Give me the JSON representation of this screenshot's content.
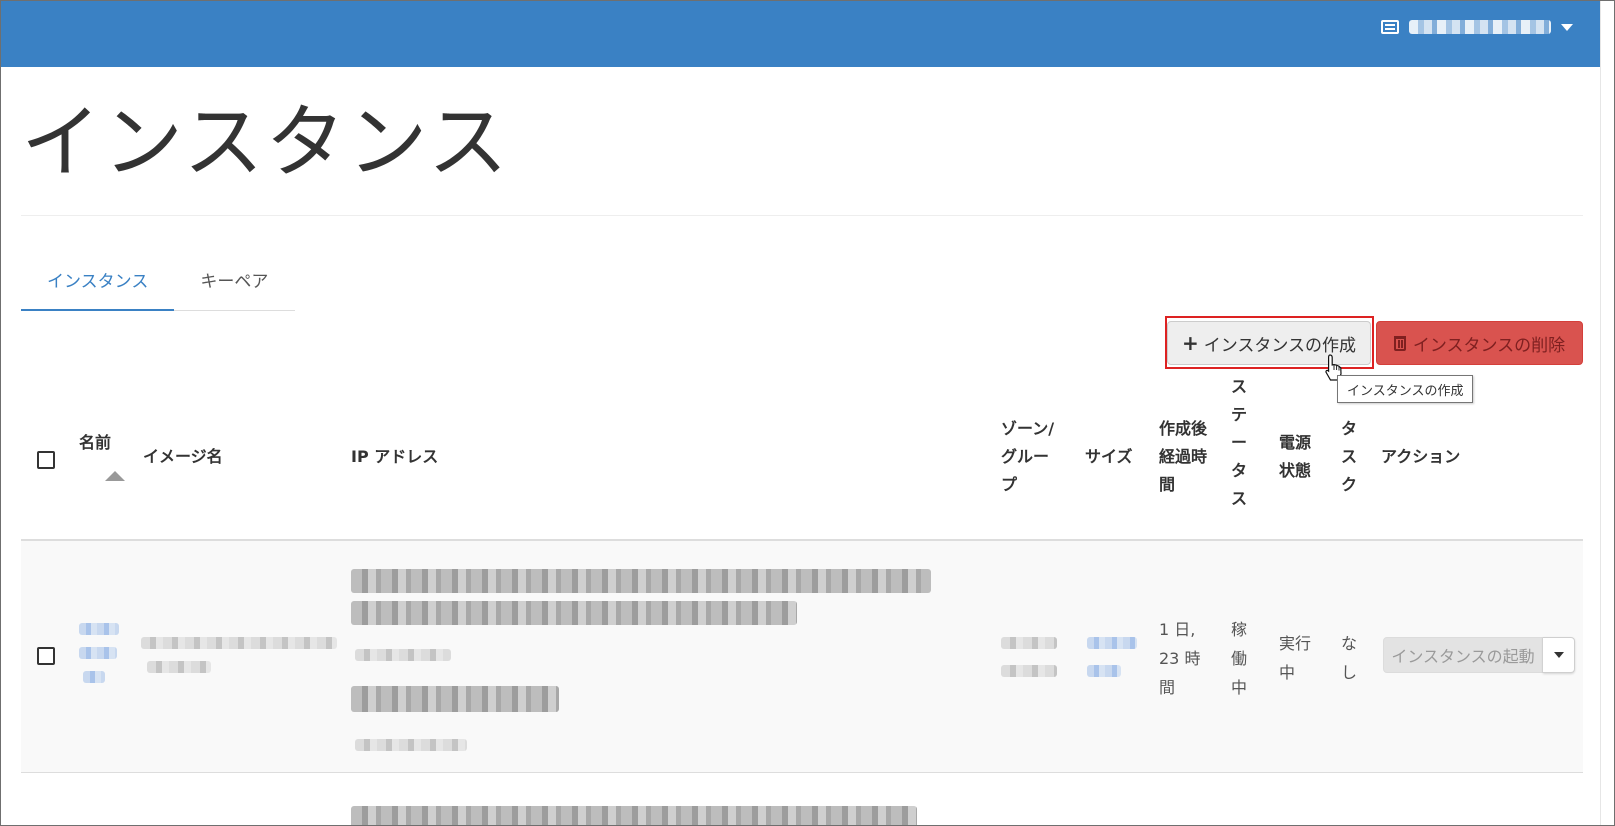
{
  "page": {
    "title": "インスタンス"
  },
  "tabs": [
    {
      "label": "インスタンス",
      "active": true
    },
    {
      "label": "キーペア",
      "active": false
    }
  ],
  "toolbar": {
    "create_label": "インスタンスの作成",
    "delete_label": "インスタンスの削除",
    "tooltip": "インスタンスの作成"
  },
  "table": {
    "headers": {
      "name": "名前",
      "image": "イメージ名",
      "ip": "IP アドレス",
      "zone_lines": [
        "ゾーン/",
        "グルー",
        "プ"
      ],
      "size": "サイズ",
      "age_lines": [
        "作成後",
        "経過時",
        "間"
      ],
      "status_lines": [
        "ス",
        "テ",
        "ー",
        "タ",
        "ス"
      ],
      "power_lines": [
        "電源",
        "状態"
      ],
      "task_lines": [
        "タ",
        "ス",
        "ク"
      ],
      "action": "アクション"
    },
    "rows": [
      {
        "age_lines": [
          "1 日,",
          "23 時",
          "間"
        ],
        "status_lines": [
          "稼",
          "働",
          "中"
        ],
        "power_lines": [
          "実行",
          "中"
        ],
        "task_lines": [
          "な",
          "し"
        ],
        "action_label": "インスタンスの起動"
      }
    ]
  },
  "colors": {
    "navbar": "#3a81c4",
    "danger": "#d9534f",
    "highlight": "#dd2222"
  }
}
